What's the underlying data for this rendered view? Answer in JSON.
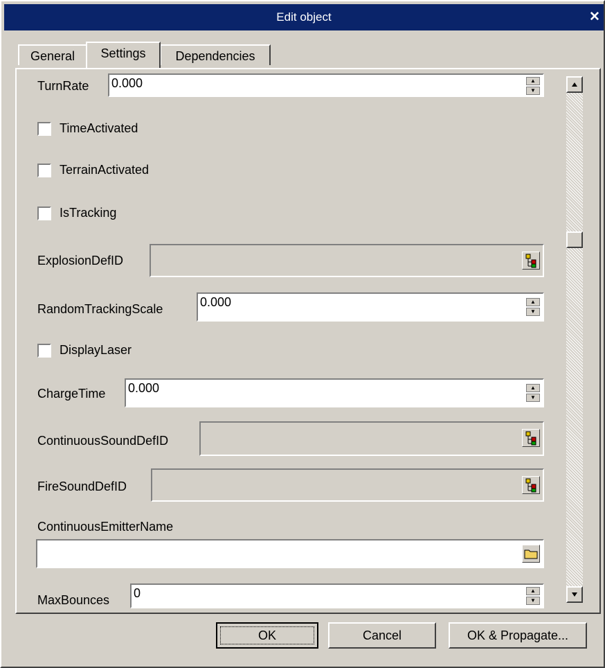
{
  "window": {
    "title": "Edit object"
  },
  "tabs": [
    {
      "label": "General"
    },
    {
      "label": "Settings"
    },
    {
      "label": "Dependencies"
    }
  ],
  "settings": {
    "turn_rate": {
      "label": "TurnRate",
      "value": "0.000"
    },
    "time_activated": {
      "label": "TimeActivated",
      "checked": false
    },
    "terrain_activated": {
      "label": "TerrainActivated",
      "checked": false
    },
    "is_tracking": {
      "label": "IsTracking",
      "checked": false
    },
    "explosion_def_id": {
      "label": "ExplosionDefID",
      "value": ""
    },
    "random_tracking_scale": {
      "label": "RandomTrackingScale",
      "value": "0.000"
    },
    "display_laser": {
      "label": "DisplayLaser",
      "checked": false
    },
    "charge_time": {
      "label": "ChargeTime",
      "value": "0.000"
    },
    "continuous_sound_def_id": {
      "label": "ContinuousSoundDefID",
      "value": ""
    },
    "fire_sound_def_id": {
      "label": "FireSoundDefID",
      "value": ""
    },
    "continuous_emitter_name": {
      "label": "ContinuousEmitterName",
      "value": ""
    },
    "max_bounces": {
      "label": "MaxBounces",
      "value": "0"
    }
  },
  "buttons": {
    "ok": "OK",
    "cancel": "Cancel",
    "ok_propagate": "OK & Propagate..."
  },
  "icons": {
    "picker": "tree-picker-icon",
    "folder": "folder-icon",
    "close": "close-icon"
  },
  "colors": {
    "titlebar": "#0a246a",
    "face": "#d4d0c8"
  }
}
